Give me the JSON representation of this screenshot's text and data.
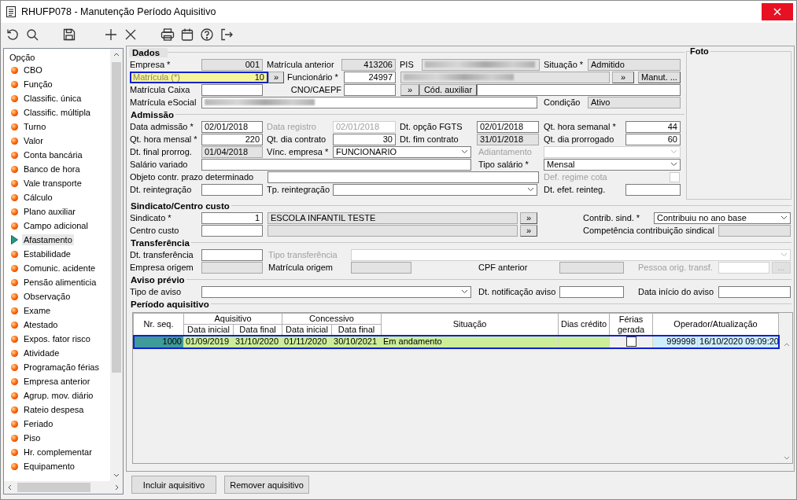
{
  "window": {
    "title": "RHUFP078 - Manutenção Período Aquisitivo"
  },
  "sidebar": {
    "title": "Opção",
    "items": [
      {
        "label": "CBO",
        "selected": false
      },
      {
        "label": "Função",
        "selected": false
      },
      {
        "label": "Classific. única",
        "selected": false
      },
      {
        "label": "Classific. múltipla",
        "selected": false
      },
      {
        "label": "Turno",
        "selected": false
      },
      {
        "label": "Valor",
        "selected": false
      },
      {
        "label": "Conta bancária",
        "selected": false
      },
      {
        "label": "Banco de hora",
        "selected": false
      },
      {
        "label": "Vale transporte",
        "selected": false
      },
      {
        "label": "Cálculo",
        "selected": false
      },
      {
        "label": "Plano auxiliar",
        "selected": false
      },
      {
        "label": "Campo adicional",
        "selected": false
      },
      {
        "label": "Afastamento",
        "selected": true
      },
      {
        "label": "Estabilidade",
        "selected": false
      },
      {
        "label": "Comunic. acidente",
        "selected": false
      },
      {
        "label": "Pensão alimenticia",
        "selected": false
      },
      {
        "label": "Observação",
        "selected": false
      },
      {
        "label": "Exame",
        "selected": false
      },
      {
        "label": "Atestado",
        "selected": false
      },
      {
        "label": "Expos. fator risco",
        "selected": false
      },
      {
        "label": "Atividade",
        "selected": false
      },
      {
        "label": "Programação férias",
        "selected": false
      },
      {
        "label": "Empresa anterior",
        "selected": false
      },
      {
        "label": "Agrup. mov. diário",
        "selected": false
      },
      {
        "label": "Rateio despesa",
        "selected": false
      },
      {
        "label": "Feriado",
        "selected": false
      },
      {
        "label": "Piso",
        "selected": false
      },
      {
        "label": "Hr. complementar",
        "selected": false
      },
      {
        "label": "Equipamento",
        "selected": false
      }
    ]
  },
  "photo": {
    "title": "Foto"
  },
  "sections": [
    {
      "title": "Dados",
      "rows": [
        {
          "items": [
            {
              "kind": "label",
              "text": "Empresa *"
            },
            {
              "kind": "number",
              "value": "001",
              "readonly": true
            },
            {
              "kind": "label",
              "text": "Matrícula anterior"
            },
            {
              "kind": "number",
              "value": "413206",
              "readonly": true
            },
            {
              "kind": "label",
              "text": "PIS"
            },
            {
              "kind": "field",
              "readonly": true,
              "blurred": true
            },
            {
              "kind": "label",
              "text": "Situação *"
            },
            {
              "kind": "field",
              "value": "Admitido",
              "readonly": true
            }
          ]
        },
        {
          "items": [
            {
              "kind": "focused",
              "label": "Matrícula (*)",
              "value": "10"
            },
            {
              "kind": "button",
              "text": "»"
            },
            {
              "kind": "label",
              "text": "Funcionário *"
            },
            {
              "kind": "number",
              "value": "24997"
            },
            {
              "kind": "field",
              "readonly": true,
              "blurred": true
            },
            {
              "kind": "button",
              "text": "»"
            },
            {
              "kind": "button",
              "text": "Manut. ..."
            }
          ]
        },
        {
          "items": [
            {
              "kind": "label",
              "text": "Matrícula Caixa"
            },
            {
              "kind": "field"
            },
            {
              "kind": "label",
              "text": "CNO/CAEPF"
            },
            {
              "kind": "field"
            },
            {
              "kind": "button",
              "text": "»"
            },
            {
              "kind": "button",
              "text": "Cód. auxiliar"
            },
            {
              "kind": "field"
            }
          ]
        },
        {
          "items": [
            {
              "kind": "label",
              "text": "Matrícula eSocial"
            },
            {
              "kind": "field",
              "blurred": true
            },
            {
              "kind": "label",
              "text": "Condição"
            },
            {
              "kind": "field",
              "value": "Ativo",
              "readonly": true
            }
          ]
        }
      ]
    },
    {
      "title": "Admissão",
      "rows": [
        {
          "items": [
            {
              "kind": "label",
              "text": "Data admissão *"
            },
            {
              "kind": "field",
              "value": "02/01/2018"
            },
            {
              "kind": "label",
              "text": "Data registro",
              "disabled": true
            },
            {
              "kind": "field",
              "value": "02/01/2018",
              "disabled": true
            },
            {
              "kind": "label",
              "text": "Dt. opção FGTS"
            },
            {
              "kind": "field",
              "value": "02/01/2018"
            },
            {
              "kind": "label",
              "text": "Qt. hora semanal *"
            },
            {
              "kind": "number",
              "value": "44"
            }
          ]
        },
        {
          "items": [
            {
              "kind": "label",
              "text": "Qt. hora mensal *"
            },
            {
              "kind": "number",
              "value": "220"
            },
            {
              "kind": "label",
              "text": "Qt. dia contrato"
            },
            {
              "kind": "number",
              "value": "30"
            },
            {
              "kind": "label",
              "text": "Dt. fim contrato"
            },
            {
              "kind": "field",
              "value": "31/01/2018",
              "readonly": true
            },
            {
              "kind": "label",
              "text": "Qt. dia prorrogado"
            },
            {
              "kind": "number",
              "value": "60"
            }
          ]
        },
        {
          "items": [
            {
              "kind": "label",
              "text": "Dt. final prorrog."
            },
            {
              "kind": "field",
              "value": "01/04/2018",
              "readonly": true
            },
            {
              "kind": "label",
              "text": "Vínc. empresa *"
            },
            {
              "kind": "select",
              "value": "FUNCIONARIO"
            },
            {
              "kind": "label",
              "text": "Adiantamento",
              "disabled": true
            },
            {
              "kind": "select",
              "disabled": true
            }
          ]
        },
        {
          "items": [
            {
              "kind": "label",
              "text": "Salário variado"
            },
            {
              "kind": "field"
            },
            {
              "kind": "label",
              "text": "Tipo salário *"
            },
            {
              "kind": "select",
              "value": "Mensal"
            }
          ]
        },
        {
          "items": [
            {
              "kind": "label",
              "text": "Objeto contr. prazo determinado"
            },
            {
              "kind": "field"
            },
            {
              "kind": "label",
              "text": "Def. regime cota",
              "disabled": true
            },
            {
              "kind": "checkbox",
              "checked": false,
              "disabled": true
            }
          ]
        },
        {
          "items": [
            {
              "kind": "label",
              "text": "Dt. reintegração"
            },
            {
              "kind": "field"
            },
            {
              "kind": "label",
              "text": "Tp. reintegração"
            },
            {
              "kind": "select"
            },
            {
              "kind": "label",
              "text": "Dt. efet. reinteg."
            },
            {
              "kind": "field"
            }
          ]
        }
      ]
    },
    {
      "title": "Sindicato/Centro custo",
      "rows": [
        {
          "items": [
            {
              "kind": "label",
              "text": "Sindicato *"
            },
            {
              "kind": "number",
              "value": "1"
            },
            {
              "kind": "field",
              "value": "ESCOLA INFANTIL TESTE",
              "readonly": true
            },
            {
              "kind": "button",
              "text": "»"
            },
            {
              "kind": "label",
              "text": "Contrib. sind. *"
            },
            {
              "kind": "select",
              "value": "Contribuiu no ano base"
            }
          ]
        },
        {
          "items": [
            {
              "kind": "label",
              "text": "Centro custo"
            },
            {
              "kind": "field"
            },
            {
              "kind": "field",
              "readonly": true
            },
            {
              "kind": "button",
              "text": "»"
            },
            {
              "kind": "label",
              "text": "Competência contribuição sindical"
            },
            {
              "kind": "field",
              "readonly": true
            }
          ]
        }
      ]
    },
    {
      "title": "Transferência",
      "rows": [
        {
          "items": [
            {
              "kind": "label",
              "text": "Dt. transferência"
            },
            {
              "kind": "field"
            },
            {
              "kind": "label",
              "text": "Tipo transferência",
              "disabled": true
            },
            {
              "kind": "select",
              "disabled": true
            }
          ]
        },
        {
          "items": [
            {
              "kind": "label",
              "text": "Empresa origem"
            },
            {
              "kind": "field",
              "readonly": true
            },
            {
              "kind": "label",
              "text": "Matrícula origem"
            },
            {
              "kind": "field",
              "readonly": true
            },
            {
              "kind": "label",
              "text": "CPF anterior"
            },
            {
              "kind": "field",
              "readonly": true
            },
            {
              "kind": "label",
              "text": "Pessoa orig. transf.",
              "disabled": true
            },
            {
              "kind": "field",
              "disabled": true
            },
            {
              "kind": "button",
              "text": "...",
              "disabled": true
            }
          ]
        }
      ]
    },
    {
      "title": "Aviso prévio",
      "rows": [
        {
          "items": [
            {
              "kind": "label",
              "text": "Tipo de aviso"
            },
            {
              "kind": "select"
            },
            {
              "kind": "label",
              "text": "Dt. notificação aviso"
            },
            {
              "kind": "field"
            },
            {
              "kind": "label",
              "text": "Data início do aviso"
            },
            {
              "kind": "field"
            }
          ]
        }
      ]
    }
  ],
  "period": {
    "title": "Período aquisitivo",
    "columns": [
      {
        "label": "Nr. seq."
      },
      {
        "group": "Aquisitivo",
        "labels": [
          "Data inicial",
          "Data final"
        ]
      },
      {
        "group": "Concessivo",
        "labels": [
          "Data inicial",
          "Data final"
        ]
      },
      {
        "label": "Situação"
      },
      {
        "label": "Dias crédito"
      },
      {
        "label": "Férias gerada"
      },
      {
        "label": "Operador/Atualização"
      }
    ],
    "rows": [
      {
        "selected": true,
        "nr_seq": "1000",
        "aquisitivo": [
          "01/09/2019",
          "31/10/2020"
        ],
        "concessivo": [
          "01/11/2020",
          "30/10/2021"
        ],
        "situacao": "Em andamento",
        "ferias_gerada": false,
        "operador": "999998",
        "atualizacao": "16/10/2020 09:09:20"
      }
    ]
  },
  "buttons": [
    "Incluir aquisitivo",
    "Remover aquisitivo"
  ]
}
